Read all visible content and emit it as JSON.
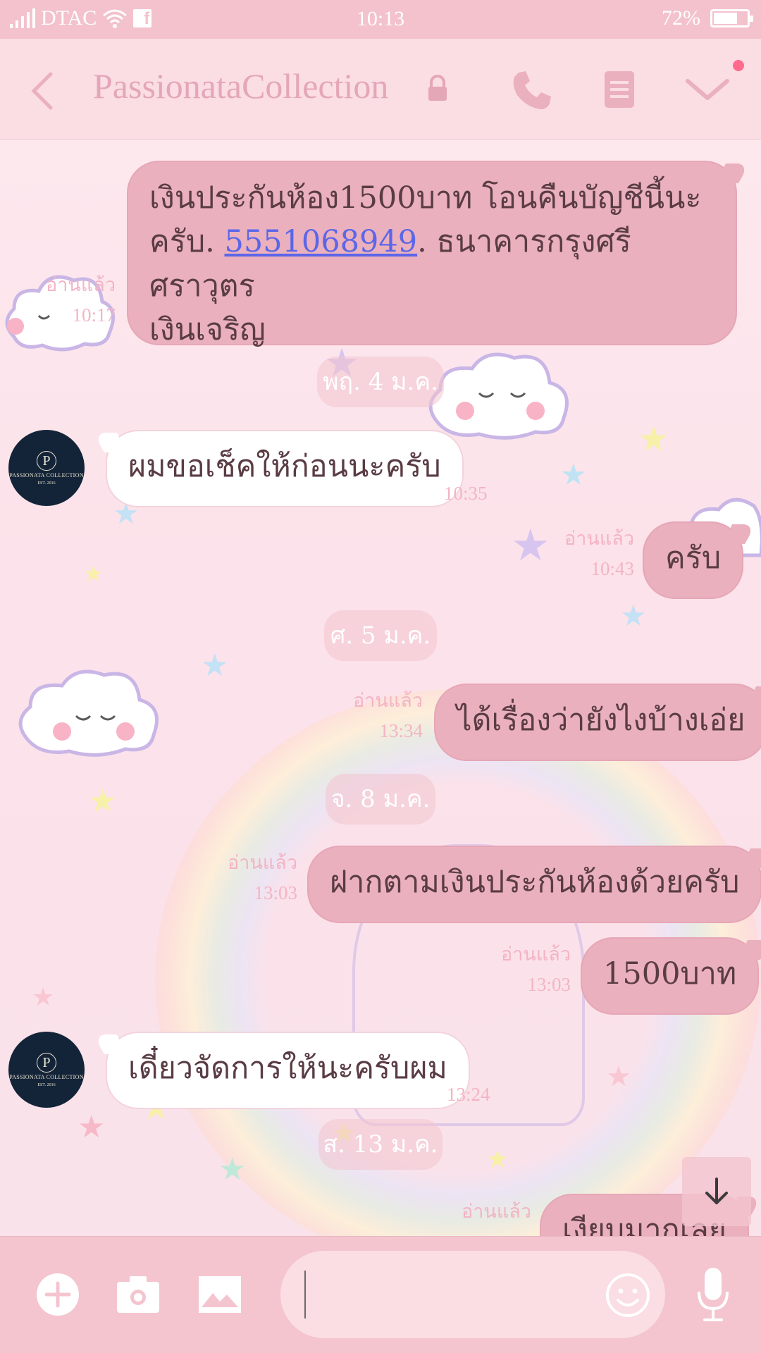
{
  "status_bar": {
    "carrier": "DTAC",
    "time": "10:13",
    "battery": "72%",
    "battery_level": 0.72
  },
  "header": {
    "title": "PassionataCollection"
  },
  "messages": [
    {
      "dir": "out",
      "lines": [
        "เงินประกันห้อง1500บาท โอนคืนบัญชีนี้นะ",
        "ครับ. ",
        "เงินเจริญ"
      ],
      "account_number": "5551068949",
      "after_link": ". ธนาคารกรุงศรี ศราวุตร",
      "read": "อ่านแล้ว",
      "time": "10:17"
    },
    {
      "dir": "in",
      "text": "ผมขอเช็คให้ก่อนนะครับ",
      "time": "10:35"
    },
    {
      "dir": "out",
      "text": "ครับ",
      "read": "อ่านแล้ว",
      "time": "10:43"
    },
    {
      "dir": "out",
      "text": "ได้เรื่องว่ายังไงบ้างเอ่ย",
      "read": "อ่านแล้ว",
      "time": "13:34"
    },
    {
      "dir": "out",
      "text": "ฝากตามเงินประกันห้องด้วยครับ",
      "read": "อ่านแล้ว",
      "time": "13:03"
    },
    {
      "dir": "out",
      "text": "1500บาท",
      "read": "อ่านแล้ว",
      "time": "13:03"
    },
    {
      "dir": "in",
      "text": "เดี๋ยวจัดการให้นะครับผม",
      "time": "13:24"
    },
    {
      "dir": "out",
      "text": "เงียบมากเลย",
      "read": "อ่านแล้ว"
    }
  ],
  "dates": [
    "พฤ. 4 ม.ค.",
    "ศ. 5 ม.ค.",
    "จ. 8 ม.ค.",
    "ส. 13 ม.ค."
  ],
  "avatar": {
    "monogram": "P",
    "brand": "PASSIONATA COLLECTION",
    "est": "EST. 2016"
  },
  "icons": [
    "back-icon",
    "lock-icon",
    "phone-icon",
    "notes-icon",
    "chevron-down-icon",
    "arrow-down-icon",
    "plus-icon",
    "camera-icon",
    "image-icon",
    "emoji-icon",
    "microphone-icon"
  ],
  "colors": {
    "status_bar": "#f3c2cd",
    "header": "#fbdde4",
    "outgoing_bubble": "#eab0be",
    "incoming_bubble": "#ffffff",
    "link": "#5b66e8",
    "notification_dot": "#ff6b8c"
  }
}
